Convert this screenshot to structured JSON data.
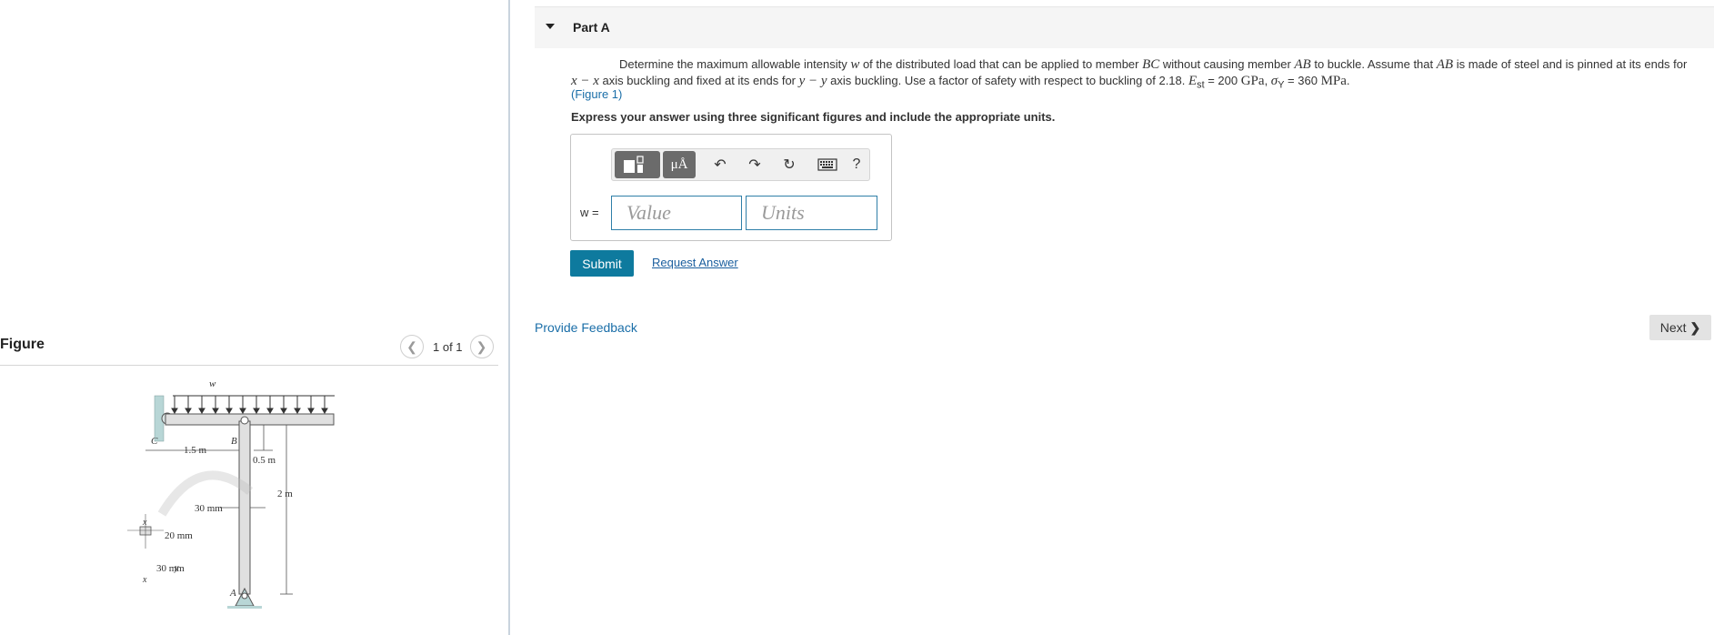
{
  "figure_panel": {
    "title": "Figure",
    "pager": {
      "prev_icon": "chevron-left-icon",
      "next_icon": "chevron-right-icon",
      "count_label": "1 of 1"
    },
    "diagram_labels": {
      "load": "w",
      "point_c": "C",
      "point_b": "B",
      "point_a": "A",
      "dim_bc": "1.5 m",
      "dim_top": "0.5 m",
      "dim_height": "2 m",
      "section_width": "30 mm",
      "section_height": "20 mm",
      "section_depth": "30 mm",
      "axis_x_top": "x",
      "axis_x_bottom": "x",
      "axis_y_left": "y",
      "axis_y_right": "y"
    }
  },
  "part": {
    "title": "Part A",
    "problem_before_w": "Determine the maximum allowable intensity ",
    "sym_w": "w",
    "problem_after_w": " of the distributed load that can be applied to member ",
    "sym_bc": "BC",
    "problem_mid1": " without causing member ",
    "sym_ab1": "AB",
    "problem_mid2": " to buckle. Assume that ",
    "sym_ab2": "AB",
    "problem_mid3": " is made of steel and is pinned at its ends for",
    "sym_xx": "x − x",
    "problem_mid4": " axis buckling and fixed at its ends for ",
    "sym_yy": "y − y",
    "problem_mid5": " axis buckling. Use a factor of safety with respect to buckling of 2.18. ",
    "sym_est": "E",
    "sub_st": "st",
    "eq1": " = 200 ",
    "unit_gpa": "GPa",
    "sep": ", ",
    "sym_sigma": "σ",
    "sub_y": "Y",
    "eq2": " = 360 ",
    "unit_mpa": "MPa",
    "end": ".",
    "figure_link": "(Figure 1)",
    "instruction": "Express your answer using three significant figures and include the appropriate units.",
    "answer": {
      "label": "w =",
      "value_placeholder": "Value",
      "units_placeholder": "Units",
      "toolbar": {
        "templates_icon": "templates-icon",
        "units_label": "μÅ",
        "undo_icon": "undo-icon",
        "redo_icon": "redo-icon",
        "reset_icon": "reset-icon",
        "keyboard_icon": "keyboard-icon",
        "help_label": "?"
      }
    },
    "submit_label": "Submit",
    "request_answer_label": "Request Answer"
  },
  "footer": {
    "feedback_label": "Provide Feedback",
    "next_label": "Next",
    "next_icon": "chevron-right-icon"
  },
  "colors": {
    "submit_bg": "#0e7a9e",
    "link": "#1a6ea8",
    "input_border": "#2f7fa8"
  }
}
